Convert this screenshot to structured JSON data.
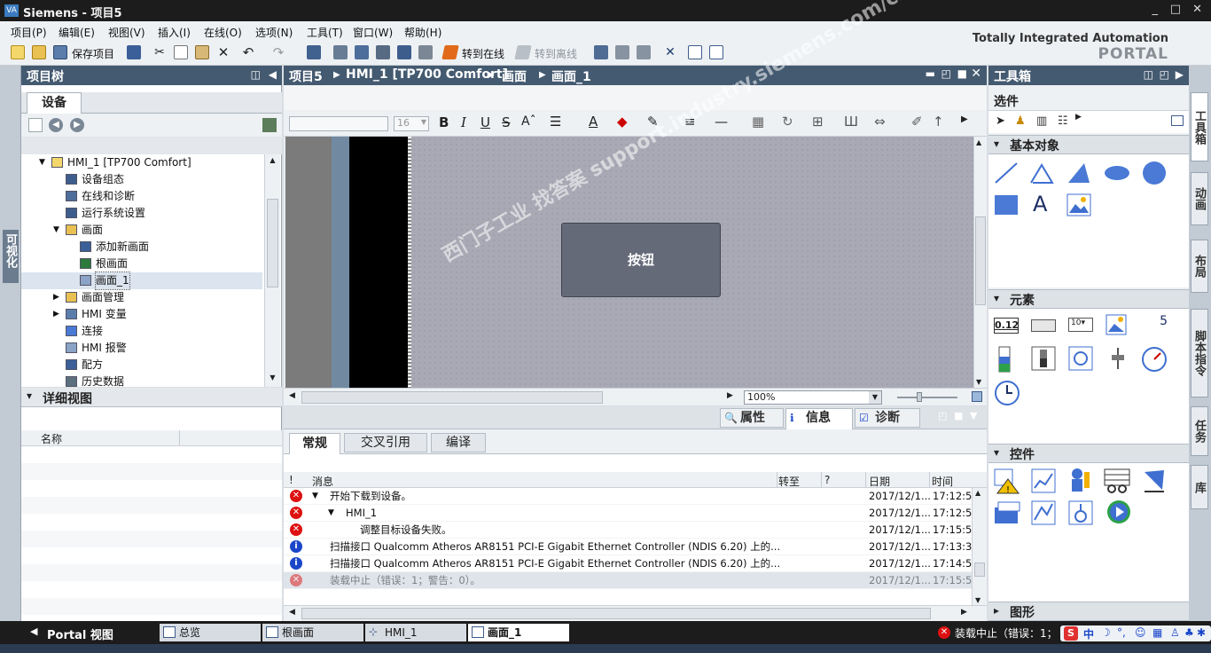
{
  "window": {
    "title": "Siemens - 项目5",
    "controls": [
      "_",
      "□",
      "✕"
    ]
  },
  "menu": [
    "项目(P)",
    "编辑(E)",
    "视图(V)",
    "插入(I)",
    "在线(O)",
    "选项(N)",
    "工具(T)",
    "窗口(W)",
    "帮助(H)"
  ],
  "toolbar": {
    "save_label": "保存项目",
    "go_online": "转到在线",
    "go_offline": "转到离线"
  },
  "brand": {
    "line1": "Totally Integrated Automation",
    "line2": "PORTAL"
  },
  "left_strip": {
    "label": "可视化"
  },
  "project_tree": {
    "title": "项目树",
    "tab": "设备",
    "items": [
      {
        "label": "HMI_1 [TP700 Comfort]",
        "indent": 1,
        "expander": "▼"
      },
      {
        "label": "设备组态",
        "indent": 2,
        "expander": ""
      },
      {
        "label": "在线和诊断",
        "indent": 2,
        "expander": ""
      },
      {
        "label": "运行系统设置",
        "indent": 2,
        "expander": ""
      },
      {
        "label": "画面",
        "indent": 2,
        "expander": "▼"
      },
      {
        "label": "添加新画面",
        "indent": 3,
        "expander": ""
      },
      {
        "label": "根画面",
        "indent": 3,
        "expander": ""
      },
      {
        "label": "画面_1",
        "indent": 3,
        "expander": ""
      },
      {
        "label": "画面管理",
        "indent": 2,
        "expander": "▶"
      },
      {
        "label": "HMI 变量",
        "indent": 2,
        "expander": "▶"
      },
      {
        "label": "连接",
        "indent": 2,
        "expander": ""
      },
      {
        "label": "HMI 报警",
        "indent": 2,
        "expander": ""
      },
      {
        "label": "配方",
        "indent": 2,
        "expander": ""
      },
      {
        "label": "历史数据",
        "indent": 2,
        "expander": ""
      }
    ]
  },
  "detail_view": {
    "title": "详细视图",
    "col_name": "名称"
  },
  "editor": {
    "breadcrumb": [
      "项目5",
      "HMI_1 [TP700 Comfort]",
      "画面",
      "画面_1"
    ],
    "font_size": "16",
    "button_label": "按钮",
    "zoom": "100%",
    "watermark": "西门子工业  找答案  support.industry.siemens.com/cs"
  },
  "inspector": {
    "top_tabs": [
      "属性",
      "信息",
      "诊断"
    ],
    "tabs": [
      "常规",
      "交叉引用",
      "编译"
    ],
    "columns": [
      "!",
      "消息",
      "转至",
      "?",
      "日期",
      "时间"
    ],
    "rows": [
      {
        "icon": "error",
        "expander": "▼",
        "indent": 0,
        "msg": "开始下载到设备。",
        "date": "2017/12/1...",
        "time": "17:12:5"
      },
      {
        "icon": "error",
        "expander": "▼",
        "indent": 1,
        "msg": "HMI_1",
        "date": "2017/12/1...",
        "time": "17:12:5"
      },
      {
        "icon": "error",
        "expander": "",
        "indent": 2,
        "msg": "调整目标设备失败。",
        "date": "2017/12/1...",
        "time": "17:15:5"
      },
      {
        "icon": "info",
        "expander": "",
        "indent": 0,
        "msg": "扫描接口 Qualcomm Atheros AR8151 PCI-E Gigabit Ethernet Controller (NDIS 6.20) 上的...",
        "date": "2017/12/1...",
        "time": "17:13:3"
      },
      {
        "icon": "info",
        "expander": "",
        "indent": 0,
        "msg": "扫描接口 Qualcomm Atheros AR8151 PCI-E Gigabit Ethernet Controller (NDIS 6.20) 上的...",
        "date": "2017/12/1...",
        "time": "17:14:5"
      },
      {
        "icon": "error-faded",
        "expander": "",
        "indent": 0,
        "msg": "装载中止（错误：1；警告：0）。",
        "date": "2017/12/1...",
        "time": "17:15:5"
      }
    ]
  },
  "toolbox": {
    "title": "工具箱",
    "select_label": "选件",
    "sections": [
      "基本对象",
      "元素",
      "控件",
      "图形"
    ],
    "text_tool": "A",
    "io_field": "0.12",
    "clock_num": "5"
  },
  "right_tabs": [
    "工具箱",
    "动画",
    "布局",
    "脚本指令",
    "任务",
    "库"
  ],
  "statusbar": {
    "portal_view": "Portal 视图",
    "tabs": [
      "总览",
      "根画面",
      "HMI_1",
      "画面_1"
    ],
    "status_msg": "装载中止（错误：1；"
  }
}
